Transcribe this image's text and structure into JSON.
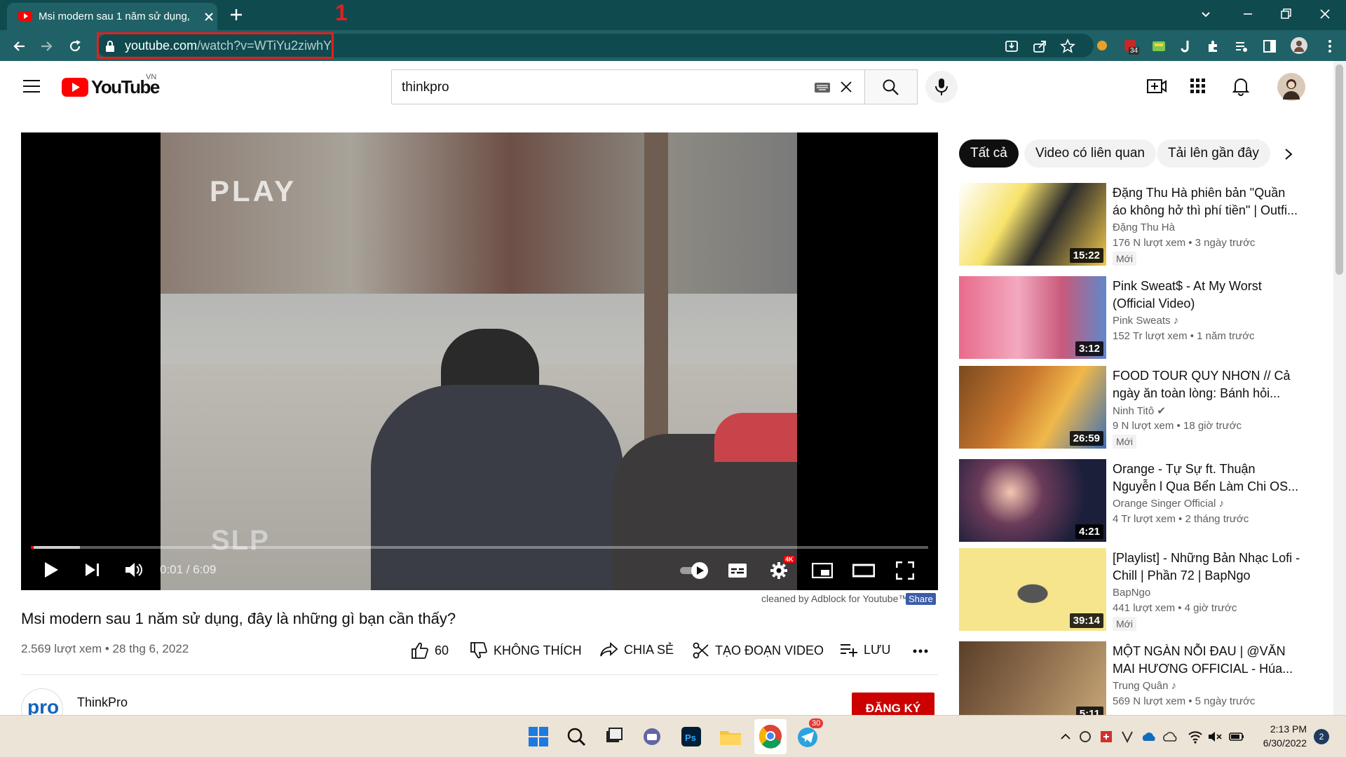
{
  "browser": {
    "tab_title": "Msi modern sau 1 năm sử dụng,",
    "annotation_number": "1",
    "url_host": "youtube.com",
    "url_path": "/watch?v=WTiYu2ziwhY",
    "extension_badge": "34"
  },
  "youtube": {
    "logo_text": "YouTube",
    "region": "VN",
    "search_value": "thinkpro"
  },
  "player": {
    "time": "0:01 / 6:09",
    "progress_percent": 0.3,
    "buffered_percent": 5.5,
    "quality_badge": "4K",
    "adblock_note": "cleaned by Adblock for Youtube™",
    "share_label": "Share",
    "video_text_play": "PLAY",
    "video_text_slp": "SLP"
  },
  "video": {
    "title": "Msi modern sau 1 năm sử dụng, đây là những gì bạn cần thấy?",
    "meta": "2.569 lượt xem • 28 thg 6, 2022",
    "like_count": "60",
    "dislike_label": "KHÔNG THÍCH",
    "share_label": "CHIA SẺ",
    "clip_label": "TẠO ĐOẠN VIDEO",
    "save_label": "LƯU",
    "channel_name": "ThinkPro",
    "channel_avatar_text": "pro",
    "subscribe_label": "ĐĂNG KÝ"
  },
  "chips": [
    "Tất cả",
    "Video có liên quan",
    "Tải lên gần đây"
  ],
  "related": [
    {
      "title": "Đặng Thu Hà phiên bản \"Quần áo không hở thì phí tiền\" | Outfi...",
      "channel": "Đặng Thu Hà",
      "stats": "176 N lượt xem • 3 ngày trước",
      "duration": "15:22",
      "badge": "Mới",
      "color": "#f2c94c"
    },
    {
      "title": "Pink Sweat$ - At My Worst (Official Video)",
      "channel": "Pink Sweats ♪",
      "stats": "152 Tr lượt xem • 1 năm trước",
      "duration": "3:12",
      "badge": "",
      "color": "#e86b8a"
    },
    {
      "title": "FOOD TOUR QUY NHƠN // Cả ngày ăn toàn lòng: Bánh hỏi...",
      "channel": "Ninh Titô ✔",
      "stats": "9 N lượt xem • 18 giờ trước",
      "duration": "26:59",
      "badge": "Mới",
      "color": "#c9772e"
    },
    {
      "title": "Orange - Tự Sự ft. Thuận Nguyễn l Qua Bển Làm Chi OS...",
      "channel": "Orange Singer Official ♪",
      "stats": "4 Tr lượt xem • 2 tháng trước",
      "duration": "4:21",
      "badge": "",
      "color": "#1b1f3a"
    },
    {
      "title": "[Playlist] - Những Bản Nhạc Lofi - Chill | Phần 72 | BapNgo",
      "channel": "BapNgo",
      "stats": "441 lượt xem • 4 giờ trước",
      "duration": "39:14",
      "badge": "Mới",
      "color": "#f6e58d"
    },
    {
      "title": "MỘT NGÀN NỖI ĐAU | @VĂN MAI HƯƠNG OFFICIAL - Húa...",
      "channel": "Trung Quân ♪",
      "stats": "569 N lượt xem • 5 ngày trước",
      "duration": "5:11",
      "badge": "",
      "color": "#8a6a4a"
    }
  ],
  "taskbar": {
    "time": "2:13 PM",
    "date": "6/30/2022",
    "telegram_badge": "30",
    "notification_count": "2"
  }
}
